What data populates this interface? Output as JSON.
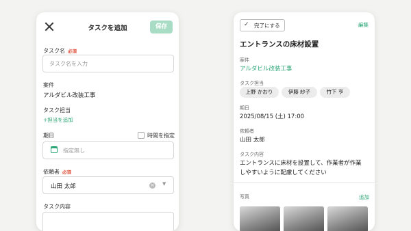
{
  "left": {
    "title": "タスクを追加",
    "save_label": "保存",
    "task_name": {
      "label": "タスク名",
      "required": "必須",
      "placeholder": "タスク名を入力"
    },
    "project": {
      "label": "案件",
      "value": "アルダビル改装工事"
    },
    "assignee": {
      "label": "タスク担当",
      "add_label": "+担当を追加"
    },
    "due": {
      "label": "期日",
      "time_toggle_label": "時間を指定",
      "placeholder": "指定無し"
    },
    "requester": {
      "label": "依頼者",
      "required": "必須",
      "value": "山田 太郎"
    },
    "content": {
      "label": "タスク内容"
    }
  },
  "right": {
    "done_label": "完了にする",
    "edit_label": "編集",
    "title": "エントランスの床材設置",
    "project": {
      "label": "案件",
      "value": "アルダビル改装工事"
    },
    "assignee": {
      "label": "タスク担当",
      "people": [
        "上野 かおり",
        "伊藤 紗子",
        "竹下 亨"
      ]
    },
    "due": {
      "label": "期日",
      "value": "2025/08/15 (土) 17:00"
    },
    "requester": {
      "label": "依頼者",
      "value": "山田 太郎"
    },
    "content": {
      "label": "タスク内容",
      "lines": [
        "エントランスに床材を設置して、作業者が作業",
        "しやすいように配慮してください"
      ]
    },
    "photos": {
      "label": "写真",
      "add_label": "追加"
    }
  },
  "colors": {
    "accent": "#2aa676",
    "required": "#e0533d",
    "save_disabled": "#a9dcc5"
  },
  "icons": [
    "close-icon",
    "calendar-icon",
    "clear-icon",
    "chevron-down-icon",
    "check-icon"
  ]
}
